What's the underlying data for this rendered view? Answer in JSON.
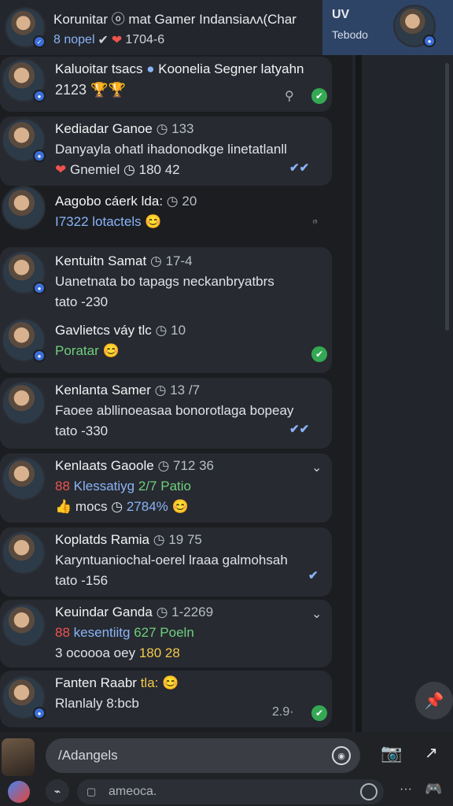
{
  "header": {
    "title": "Korunitar ⓞ mat Gamer Indansiaᴧᴧ(Char",
    "sub_prefix": "8 nopel",
    "sub_value": "1704-6"
  },
  "profile": {
    "name": "UV",
    "subtitle": "Tebodo"
  },
  "messages": [
    {
      "name": "Kaluoitar tsacs",
      "extra": "Koonelia Segner latyahn",
      "line1": "2123 🏆🏆",
      "meta": "✔"
    },
    {
      "name": "Kediadar Ganoe",
      "time": "133",
      "line1": "Danyayla ohatl ihadonodkge linetatlanll",
      "line2_label": "Gnemiel",
      "line2_value": "180 42"
    },
    {
      "name": "Aagobo cáerk lda:",
      "time": "20",
      "line1": "I7322 lotactels",
      "meta": "ᵎ⁵"
    },
    {
      "name": "Kentuitn Samat",
      "time": "17-4",
      "line1": "Uanetnata bo tapags neckanbryatbrs",
      "line2": "tato -230"
    },
    {
      "name": "Gavlietcs váy tlc",
      "time": "10",
      "line1": "Poratar"
    },
    {
      "name": "Kenlanta Samer",
      "time": "13 /7",
      "line1": "Faoee abllinoeasaa bonorotlaga bopeay",
      "line2": "tato -330"
    },
    {
      "name": "Kenlaats Gaoole",
      "time": "712 36",
      "line1_red": "88",
      "line1_blue": "Klessatiyg",
      "line1_green": "2/7 Patio",
      "line2_a": "mocs",
      "line2_b": "2784%"
    },
    {
      "name": "Koplatds Ramia",
      "time": "19 75",
      "line1": "Karyntuaniochal-oerel lraaa galmohsah",
      "line2": "tato -156"
    },
    {
      "name": "Keuindar Ganda",
      "time": "1-2269",
      "line1_red": "88",
      "line1_blue": "kesentiitg",
      "line1_green": "627 Poeln",
      "line2_a": "3 ocoooa oey",
      "line2_b": "180 28"
    },
    {
      "name": "Fanten Raabr",
      "name_extra": "tla:",
      "line1": "Rlanlaly 8:bcb",
      "meta": "2.9·"
    }
  ],
  "composer": {
    "input_value": "/Adangels",
    "secondary_placeholder": "ameoca."
  },
  "colors": {
    "background": "#1e2024",
    "bubble": "#272a30",
    "profile_card": "#2e4466",
    "accent_blue": "#8ab4f8",
    "accent_green": "#34a853"
  }
}
